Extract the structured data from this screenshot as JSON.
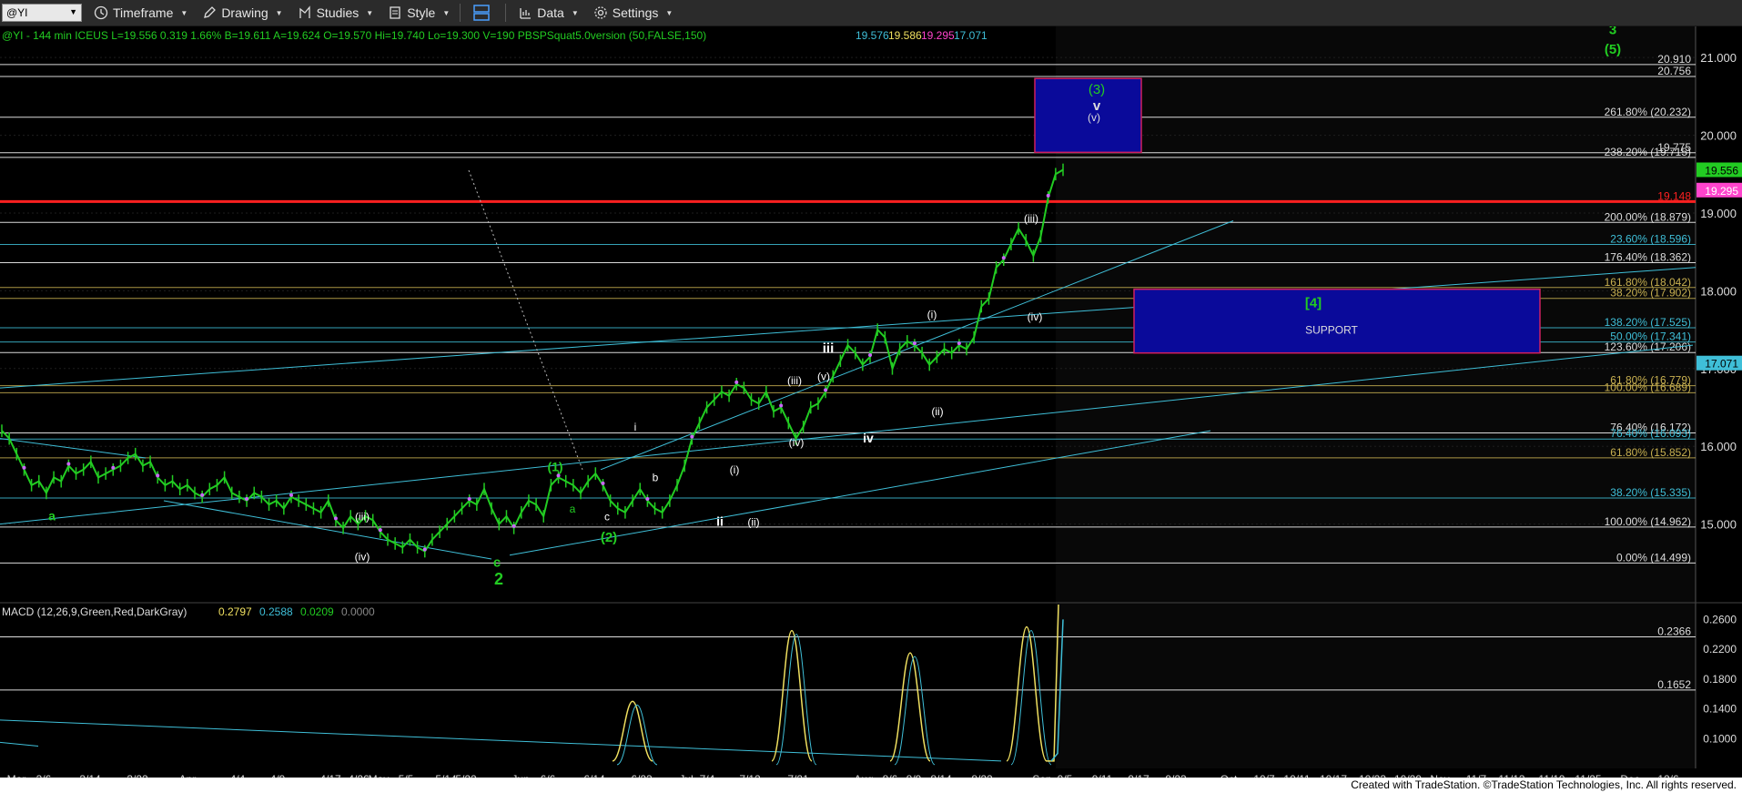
{
  "toolbar": {
    "symbol": "@YI",
    "items": [
      {
        "label": "Timeframe",
        "icon": "clock-icon"
      },
      {
        "label": "Drawing",
        "icon": "pencil-icon"
      },
      {
        "label": "Studies",
        "icon": "studies-icon"
      },
      {
        "label": "Style",
        "icon": "style-icon"
      },
      {
        "label": "",
        "icon": "layout-icon"
      },
      {
        "label": "Data",
        "icon": "data-icon"
      },
      {
        "label": "Settings",
        "icon": "gear-icon"
      }
    ]
  },
  "header": {
    "symbol_line": "@YI - 144 min  ICEUS  L=19.556  0.319  1.66%  B=19.611  A=19.624  O=19.570  Hi=19.740  Lo=19.300  V=190  PBSPSquat5.0version (50,FALSE,150)",
    "ind_values": [
      "19.576",
      "19.586",
      "19.295",
      "17.071"
    ],
    "ind_colors": [
      "#3fbfd8",
      "#f0e060",
      "#ff44cc",
      "#3fbfd8"
    ]
  },
  "macd_header": {
    "label": "MACD (12,26,9,Green,Red,DarkGray)",
    "values": [
      "0.2797",
      "0.2588",
      "0.0209",
      "0.0000"
    ],
    "colors": [
      "#f0e060",
      "#3fbfd8",
      "#22cc22",
      "#888888"
    ]
  },
  "footer": {
    "text": "Created with TradeStation. ©TradeStation Technologies, Inc. All rights reserved."
  },
  "chart_data": [
    {
      "type": "line",
      "name": "price",
      "ylim": [
        14.0,
        21.4
      ],
      "price_axis_ticks": [
        15.0,
        16.0,
        17.0,
        18.0,
        19.0,
        20.0,
        21.0
      ],
      "price_axis_labels": [
        "15.000",
        "16.000",
        "17.000",
        "18.000",
        "19.000",
        "20.000",
        "21.000"
      ],
      "last_price": "19.556",
      "axis_tags": [
        {
          "text": "19.556",
          "value": 19.556,
          "bg": "#22cc22",
          "fg": "#000"
        },
        {
          "text": "19.295",
          "value": 19.295,
          "bg": "#ff44cc",
          "fg": "#fff"
        },
        {
          "text": "17.071",
          "value": 17.071,
          "bg": "#3fbfd8",
          "fg": "#000"
        }
      ],
      "x_tick_labels": [
        "Mar",
        "3/6",
        "3/14",
        "3/22",
        "Apr",
        "4/4",
        "4/9",
        "4/17",
        "4/26",
        "May",
        "5/5",
        "5/14",
        "5/22",
        "Jun",
        "6/6",
        "6/14",
        "6/23",
        "Jul",
        "7/4",
        "7/12",
        "7/21",
        "Aug",
        "8/6",
        "8/9",
        "8/14",
        "8/22",
        "Sep",
        "9/5",
        "9/11",
        "9/17",
        "9/23",
        "Oct",
        "10/7",
        "10/11",
        "10/17",
        "10/23",
        "10/29",
        "Nov",
        "11/7",
        "11/13",
        "11/19",
        "11/25",
        "Dec",
        "12/6"
      ],
      "price_series": [
        [
          16.2,
          16.1,
          15.9,
          15.7,
          15.5,
          15.55,
          15.4,
          15.6,
          15.55,
          15.75,
          15.65,
          15.7,
          15.8,
          15.6,
          15.65,
          15.7,
          15.75,
          15.85,
          15.9,
          15.75,
          15.8,
          15.6,
          15.5,
          15.55,
          15.45,
          15.5,
          15.4,
          15.35,
          15.45,
          15.5,
          15.6,
          15.4,
          15.35,
          15.3,
          15.4,
          15.35,
          15.25,
          15.3,
          15.2,
          15.35,
          15.3,
          15.25,
          15.2,
          15.15,
          15.3,
          15.05,
          14.95,
          15.1,
          15.0,
          15.1,
          15.05,
          14.9,
          14.8,
          14.75,
          14.7,
          14.8,
          14.7,
          14.65,
          14.8,
          14.9,
          15.0,
          15.1,
          15.2,
          15.3,
          15.25,
          15.45,
          15.2,
          15.0,
          15.1,
          14.95,
          15.15,
          15.3,
          15.25,
          15.1,
          15.5,
          15.6,
          15.55,
          15.5,
          15.4,
          15.55,
          15.65,
          15.5,
          15.3,
          15.2,
          15.15,
          15.3,
          15.45,
          15.3,
          15.2,
          15.15,
          15.3,
          15.5,
          15.75,
          16.1,
          16.3,
          16.5,
          16.6,
          16.7,
          16.65,
          16.8,
          16.75,
          16.6,
          16.55,
          16.7,
          16.45,
          16.5,
          16.3,
          16.1,
          16.25,
          16.5,
          16.55,
          16.7,
          16.9,
          17.1,
          17.3,
          17.2,
          17.05,
          17.15,
          17.5,
          17.4,
          17.0,
          17.25,
          17.35,
          17.3,
          17.2,
          17.05,
          17.15,
          17.25,
          17.2,
          17.3,
          17.25,
          17.4,
          17.8,
          17.9,
          18.3,
          18.4,
          18.6,
          18.8,
          18.65,
          18.45,
          18.7,
          19.2,
          19.5,
          19.556
        ]
      ],
      "fib_levels": [
        {
          "text": "20.910",
          "value": 20.91
        },
        {
          "text": "20.756",
          "value": 20.756
        },
        {
          "text": "261.80% (20.232)",
          "value": 20.232
        },
        {
          "text": "238.20% (19.715)",
          "value": 19.715
        },
        {
          "text": "19.775",
          "value": 19.775
        },
        {
          "text": "19.148",
          "value": 19.148,
          "color": "#ff2020"
        },
        {
          "text": "200.00% (18.879)",
          "value": 18.879
        },
        {
          "text": "23.60% (18.596)",
          "value": 18.596,
          "color": "#3fbfd8"
        },
        {
          "text": "176.40% (18.362)",
          "value": 18.362
        },
        {
          "text": "161.80% (18.042)",
          "value": 18.042,
          "color": "#c8b050"
        },
        {
          "text": "38.20% (17.902)",
          "value": 17.902,
          "color": "#c8b050"
        },
        {
          "text": "138.20% (17.525)",
          "value": 17.525,
          "color": "#3fbfd8"
        },
        {
          "text": "50.00% (17.341)",
          "value": 17.341,
          "color": "#3fbfd8"
        },
        {
          "text": "123.60% (17.206)",
          "value": 17.206
        },
        {
          "text": "61.80% (16.779)",
          "value": 16.779,
          "color": "#c8b050"
        },
        {
          "text": "100.00% (16.689)",
          "value": 16.689,
          "color": "#c8b050"
        },
        {
          "text": "76.40% (16.172)",
          "value": 16.172
        },
        {
          "text": "76.40% (16.093)",
          "value": 16.093,
          "color": "#3fbfd8"
        },
        {
          "text": "61.80% (15.852)",
          "value": 15.852,
          "color": "#c8b050"
        },
        {
          "text": "38.20% (15.335)",
          "value": 15.335,
          "color": "#3fbfd8"
        },
        {
          "text": "100.00% (14.962)",
          "value": 14.962
        },
        {
          "text": "0.00% (14.499)",
          "value": 14.499
        }
      ],
      "target_box_top": {
        "label": "(3)",
        "sub_labels": [
          "v",
          "(v)"
        ],
        "range": [
          19.78,
          20.73
        ]
      },
      "support_box": {
        "label": "[4]",
        "sub_label": "SUPPORT",
        "range": [
          17.2,
          18.02
        ]
      },
      "wave_labels": [
        {
          "text": "(1)",
          "color": "#22cc22"
        },
        {
          "text": "(2)",
          "color": "#22cc22"
        },
        {
          "text": "2",
          "color": "#22cc22"
        },
        {
          "text": "c",
          "color": "#22cc22"
        },
        {
          "text": "a",
          "color": "#22cc22"
        },
        {
          "text": "a",
          "color": "#22cc22"
        },
        {
          "text": "c",
          "color": "#ffffff"
        },
        {
          "text": "i",
          "color": "#ffffff"
        },
        {
          "text": "ii",
          "color": "#ffffff"
        },
        {
          "text": "iii",
          "color": "#ffffff"
        },
        {
          "text": "iv",
          "color": "#ffffff"
        },
        {
          "text": "(i)",
          "color": "#ffffff"
        },
        {
          "text": "(ii)",
          "color": "#ffffff"
        },
        {
          "text": "(iii)",
          "color": "#ffffff"
        },
        {
          "text": "(iv)",
          "color": "#ffffff"
        },
        {
          "text": "(v)",
          "color": "#ffffff"
        },
        {
          "text": "(i)",
          "color": "#ffffff"
        },
        {
          "text": "(ii)",
          "color": "#ffffff"
        },
        {
          "text": "(iii)",
          "color": "#ffffff"
        },
        {
          "text": "(iv)",
          "color": "#ffffff"
        },
        {
          "text": "(iii)",
          "color": "#ffffff"
        },
        {
          "text": "(iv)",
          "color": "#ffffff"
        },
        {
          "text": "b",
          "color": "#ffffff"
        },
        {
          "text": "3",
          "color": "#22cc22"
        },
        {
          "text": "(5)",
          "color": "#22cc22"
        }
      ]
    },
    {
      "type": "line",
      "name": "macd",
      "ylim": [
        0.06,
        0.28
      ],
      "axis_labels": [
        "0.2600",
        "0.2200",
        "0.1800",
        "0.1400",
        "0.1000"
      ],
      "axis_values": [
        0.26,
        0.22,
        0.18,
        0.14,
        0.1
      ],
      "level_labels": [
        {
          "text": "0.2366",
          "value": 0.2366
        },
        {
          "text": "0.1652",
          "value": 0.1652
        }
      ]
    }
  ]
}
